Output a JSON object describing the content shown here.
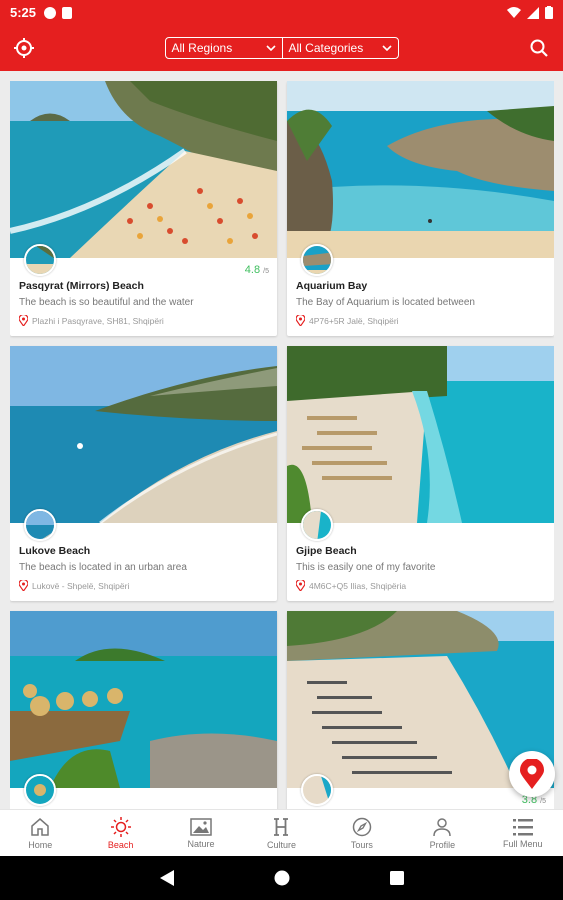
{
  "status_bar": {
    "time": "5:25"
  },
  "app_bar": {
    "regions_select": "All Regions",
    "categories_select": "All Categories"
  },
  "cards": [
    {
      "title": "Pasqyrat (Mirrors) Beach",
      "rating": "4.8",
      "rating_scale": "/5",
      "description": "The beach is so beautiful and the water",
      "address": "Plazhi i Pasqyrave, SH81, Shqipëri"
    },
    {
      "title": "Aquarium Bay",
      "rating": "",
      "rating_scale": "",
      "description": "The Bay of Aquarium is located between",
      "address": "4P76+5R Jalë, Shqipëri"
    },
    {
      "title": "Lukove Beach",
      "rating": "",
      "rating_scale": "",
      "description": "The beach is located in an urban area",
      "address": "Lukovë - Shpelë, Shqipëri"
    },
    {
      "title": "Gjipe Beach",
      "rating": "",
      "rating_scale": "",
      "description": "This is easily one of my favorite",
      "address": "4M6C+Q5 Ilias, Shqipëria"
    },
    {
      "title": "",
      "rating": "",
      "rating_scale": "",
      "description": "",
      "address": ""
    },
    {
      "title": "",
      "rating": "3.8",
      "rating_scale": "/5",
      "description": "",
      "address": ""
    }
  ],
  "bottom_nav": {
    "items": [
      {
        "label": "Home",
        "icon": "home-icon"
      },
      {
        "label": "Beach",
        "icon": "sun-icon"
      },
      {
        "label": "Nature",
        "icon": "image-icon"
      },
      {
        "label": "Culture",
        "icon": "culture-icon"
      },
      {
        "label": "Tours",
        "icon": "compass-icon"
      },
      {
        "label": "Profile",
        "icon": "person-icon"
      },
      {
        "label": "Full Menu",
        "icon": "menu-icon"
      }
    ]
  },
  "colors": {
    "brand": "#e51f1f",
    "rating": "#3fbf5f"
  }
}
